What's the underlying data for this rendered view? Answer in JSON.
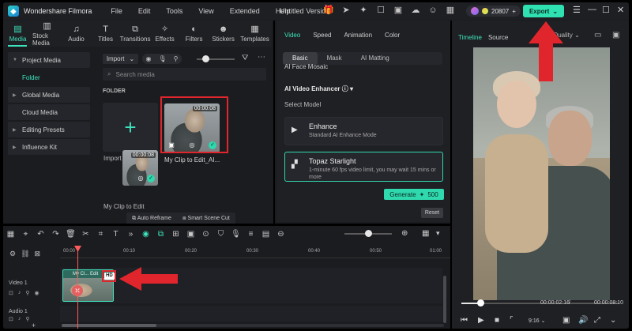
{
  "app": {
    "name": "Wondershare Filmora",
    "doc_title": "Untitled",
    "menu": [
      "File",
      "Edit",
      "Tools",
      "View",
      "Extended",
      "Help",
      "Version"
    ],
    "credits": "20807",
    "export_label": "Export"
  },
  "media_tabs": [
    "Media",
    "Stock Media",
    "Audio",
    "Titles",
    "Transitions",
    "Effects",
    "Filters",
    "Stickers",
    "Templates"
  ],
  "sidebar": {
    "items": [
      {
        "label": "Project Media",
        "arrow": true
      },
      {
        "label": "Folder",
        "arrow": false,
        "active": true
      },
      {
        "label": "Global Media",
        "arrow": true
      },
      {
        "label": "Cloud Media",
        "arrow": false
      },
      {
        "label": "Editing Presets",
        "arrow": true
      },
      {
        "label": "Influence Kit",
        "arrow": true
      }
    ]
  },
  "media": {
    "import_label": "Import",
    "search_placeholder": "Search media",
    "folder_label": "FOLDER",
    "import_media_label": "Import Media",
    "clips": [
      {
        "name": "My Clip to Edit_AI...",
        "duration": "00:00:08"
      },
      {
        "name": "My Clip to Edit",
        "duration": "00:00:08"
      }
    ],
    "auto_reframe": "Auto Reframe",
    "smart_scene_cut": "Smart Scene Cut"
  },
  "props": {
    "tabs": [
      "Video",
      "Speed",
      "Animation",
      "Color"
    ],
    "sub_tabs": [
      "Basic",
      "Mask",
      "AI Matting"
    ],
    "face_mosaic": "AI Face Mosaic",
    "enhancer": "AI Video Enhancer",
    "select_model": "Select Model",
    "models": [
      {
        "title": "Enhance",
        "desc": "Standard AI Enhance Mode"
      },
      {
        "title": "Topaz Starlight",
        "desc": "1-minute 60 fps video limit, you may wait 15 mins or more"
      }
    ],
    "generate_label": "Generate",
    "generate_cost": "500",
    "reset_label": "Reset"
  },
  "preview": {
    "tabs": [
      "Timeline",
      "Source"
    ],
    "quality": "Quality",
    "current_time": "00:00:02:16",
    "total_time": "00:00:08:10",
    "ratio": "9:16",
    "progress": 0.12
  },
  "timeline": {
    "ticks": [
      "00:00",
      "00:10",
      "00:20",
      "00:30",
      "00:40",
      "00:50",
      "01:00"
    ],
    "video_track": "Video 1",
    "audio_track": "Audio 1",
    "clip_label": "My Cl... Edit",
    "hd_badge": "HD"
  },
  "colors": {
    "accent": "#3ee3bd",
    "highlight_red": "#e0262c",
    "background": "#1b1c20"
  }
}
